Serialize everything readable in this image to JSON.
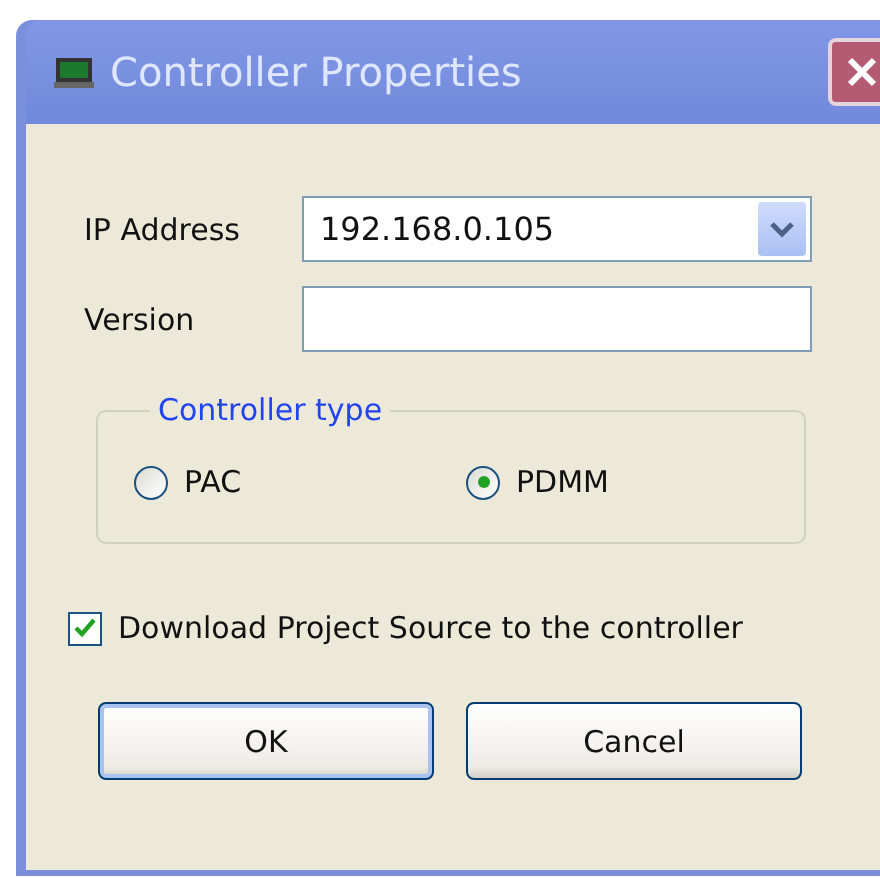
{
  "window": {
    "title": "Controller Properties"
  },
  "fields": [
    {
      "kind": "combo",
      "label": "IP Address",
      "value": "192.168.0.105"
    },
    {
      "kind": "text",
      "label": "Version"
    }
  ],
  "controller_type": {
    "title": "Controller type",
    "options": [
      {
        "label": "PAC",
        "selected": false
      },
      {
        "label": "PDMM",
        "selected": true
      }
    ]
  },
  "download_source": {
    "label": "Download Project Source to the controller",
    "checked": true
  },
  "buttons": [
    {
      "label": "OK",
      "default": true
    },
    {
      "label": "Cancel",
      "default": false
    }
  ]
}
